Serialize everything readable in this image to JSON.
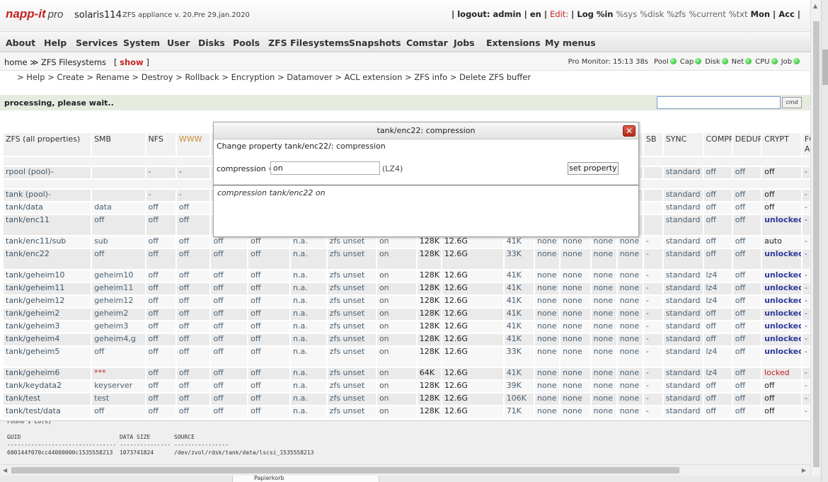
{
  "header": {
    "logo_text": "napp-it",
    "logo_pro": "pro",
    "hostname": "solaris114",
    "appliance": "ZFS appliance v. 20.Pre 29.jan.2020",
    "right_items": [
      "|",
      "logout: admin",
      "|",
      "en",
      "|",
      "Edit:",
      "|",
      "Log %in",
      "%sys",
      "%disk",
      "%zfs",
      "%current",
      "%txt",
      "Mon",
      "|",
      "Acc",
      "|"
    ]
  },
  "menu": [
    "About",
    "Help",
    "Services",
    "System",
    "User",
    "Disks",
    "Pools",
    "ZFS Filesystems",
    "Snapshots",
    "Comstar",
    "Jobs",
    "Extensions",
    "My menus"
  ],
  "breadcrumb": {
    "text": "home ≫ ZFS Filesystems   [",
    "show": "show",
    "close": "]"
  },
  "promonitor": {
    "label": "Pro Monitor: 15:13 38s",
    "items": [
      "Pool",
      "Cap",
      "Disk",
      "Net",
      "CPU",
      "Job"
    ]
  },
  "subnav": "> Help > Create > Rename > Destroy > Rollback > Encryption > Datamover > ACL extension > ZFS info > Delete ZFS buffer",
  "processing": "processing, please wait..",
  "cmd_label": "cmd",
  "table": {
    "headers": [
      "ZFS (all properties)",
      "SMB",
      "NFS",
      "WWW",
      "",
      "",
      "",
      "",
      "",
      "",
      "",
      "",
      "",
      "",
      "",
      "",
      "SB",
      "SYNC",
      "COMPR",
      "DEDUP",
      "CRYPT",
      "FO ACL"
    ],
    "rows": [
      {
        "type": "sp"
      },
      {
        "type": "w1",
        "cells": [
          "rpool (pool)-",
          "",
          "-",
          "-",
          "",
          "",
          "",
          "",
          "",
          "",
          "",
          "",
          "",
          "",
          "",
          "",
          "",
          "standard",
          "off",
          "off",
          "off",
          "-"
        ]
      },
      {
        "type": "sp"
      },
      {
        "type": "w1",
        "cells": [
          "tank (pool)-",
          "",
          "-",
          "-",
          "",
          "",
          "",
          "",
          "",
          "",
          "",
          "",
          "",
          "",
          "",
          "",
          "",
          "standard",
          "off",
          "off",
          "off",
          "-"
        ]
      },
      {
        "type": "w2",
        "cells": [
          "tank/data",
          "data",
          "off",
          "off",
          "",
          "",
          "",
          "",
          "",
          "",
          "",
          "",
          "",
          "",
          "",
          "",
          "",
          "standard",
          "off",
          "off",
          "off",
          "-"
        ]
      },
      {
        "type": "w1",
        "tall": true,
        "cells": [
          "tank/enc11",
          "off",
          "off",
          "off",
          "",
          "",
          "",
          "",
          "",
          "",
          "",
          "",
          "",
          "",
          "",
          "",
          "",
          "standard",
          "off",
          "off",
          "unlocked",
          "-"
        ]
      },
      {
        "type": "w2",
        "cells": [
          "tank/enc11/sub",
          "sub",
          "off",
          "off",
          "off",
          "off",
          "n.a.",
          "zfs unset",
          "on",
          "128K",
          "12.6G",
          "41K",
          "none",
          "none",
          "none",
          "none",
          "-",
          "standard",
          "off",
          "off",
          "auto",
          "-"
        ]
      },
      {
        "type": "w1",
        "tall": true,
        "cells": [
          "tank/enc22",
          "off",
          "off",
          "off",
          "off",
          "off",
          "n.a.",
          "zfs unset",
          "on",
          "128K",
          "12.6G",
          "33K",
          "none",
          "none",
          "none",
          "none",
          "-",
          "standard",
          "off",
          "off",
          "unlocked",
          "-"
        ]
      },
      {
        "type": "w2",
        "cells": [
          "tank/geheim10",
          "geheim10",
          "off",
          "off",
          "off",
          "off",
          "n.a.",
          "zfs unset",
          "on",
          "128K",
          "12.6G",
          "41K",
          "none",
          "none",
          "none",
          "none",
          "-",
          "standard",
          "lz4",
          "off",
          "unlocked",
          "-"
        ]
      },
      {
        "type": "w1",
        "cells": [
          "tank/geheim11",
          "geheim11",
          "off",
          "off",
          "off",
          "off",
          "n.a.",
          "zfs unset",
          "on",
          "128K",
          "12.6G",
          "41K",
          "none",
          "none",
          "none",
          "none",
          "-",
          "standard",
          "lz4",
          "off",
          "unlocked",
          "-"
        ]
      },
      {
        "type": "w2",
        "cells": [
          "tank/geheim12",
          "geheim12",
          "off",
          "off",
          "off",
          "off",
          "n.a.",
          "zfs unset",
          "on",
          "128K",
          "12.6G",
          "41K",
          "none",
          "none",
          "none",
          "none",
          "-",
          "standard",
          "lz4",
          "off",
          "unlocked",
          "-"
        ]
      },
      {
        "type": "w1",
        "cells": [
          "tank/geheim2",
          "geheim2",
          "off",
          "off",
          "off",
          "off",
          "n.a.",
          "zfs unset",
          "on",
          "128K",
          "12.6G",
          "41K",
          "none",
          "none",
          "none",
          "none",
          "-",
          "standard",
          "off",
          "off",
          "unlocked",
          "-"
        ]
      },
      {
        "type": "w2",
        "cells": [
          "tank/geheim3",
          "geheim3",
          "off",
          "off",
          "off",
          "off",
          "n.a.",
          "zfs unset",
          "on",
          "128K",
          "12.6G",
          "41K",
          "none",
          "none",
          "none",
          "none",
          "-",
          "standard",
          "off",
          "off",
          "unlocked",
          "-"
        ]
      },
      {
        "type": "w1",
        "cells": [
          "tank/geheim4",
          "geheim4,g",
          "off",
          "off",
          "off",
          "off",
          "n.a.",
          "zfs unset",
          "on",
          "128K",
          "12.6G",
          "41K",
          "none",
          "none",
          "none",
          "none",
          "-",
          "standard",
          "off",
          "off",
          "unlocked",
          "-"
        ]
      },
      {
        "type": "w2",
        "tall": true,
        "cells": [
          "tank/geheim5",
          "off",
          "off",
          "off",
          "off",
          "off",
          "n.a.",
          "zfs unset",
          "on",
          "128K",
          "12.6G",
          "33K",
          "none",
          "none",
          "none",
          "none",
          "-",
          "standard",
          "lz4",
          "off",
          "unlocked",
          "-"
        ]
      },
      {
        "type": "w1",
        "cells": [
          "tank/geheim6",
          "***",
          "off",
          "off",
          "off",
          "off",
          "n.a.",
          "zfs unset",
          "on",
          "64K",
          "12.6G",
          "41K",
          "none",
          "none",
          "none",
          "none",
          "-",
          "standard",
          "lz4",
          "off",
          "locked",
          "-"
        ]
      },
      {
        "type": "w2",
        "cells": [
          "tank/keydata2",
          "keyserver",
          "off",
          "off",
          "off",
          "off",
          "n.a.",
          "zfs unset",
          "on",
          "128K",
          "12.6G",
          "39K",
          "none",
          "none",
          "none",
          "none",
          "-",
          "standard",
          "off",
          "off",
          "off",
          "-"
        ]
      },
      {
        "type": "w1",
        "cells": [
          "tank/test",
          "test",
          "off",
          "off",
          "off",
          "off",
          "n.a.",
          "zfs unset",
          "on",
          "128K",
          "12.6G",
          "106K",
          "none",
          "none",
          "none",
          "none",
          "-",
          "standard",
          "off",
          "off",
          "off",
          "-"
        ]
      },
      {
        "type": "w2",
        "cells": [
          "tank/test/data",
          "off",
          "off",
          "off",
          "off",
          "off",
          "n.a.",
          "zfs unset",
          "on",
          "128K",
          "12.6G",
          "71K",
          "none",
          "none",
          "none",
          "none",
          "-",
          "standard",
          "off",
          "off",
          "off",
          "-"
        ]
      }
    ]
  },
  "bottom_lines": [
    "Found 1 LU(s)",
    "",
    "GUID                             DATA SIZE       SOURCE",
    "-------------------------------- --------------- ----------------",
    "600144f070cc44000000c1535558213  1073741824      /dev/zvol/rdsk/tank/data/lscsi_1535558213"
  ],
  "dialog": {
    "title": "tank/enc22: compression",
    "heading": "Change property tank/enc22/: compression",
    "prop_label": "compression =",
    "prop_value": "on",
    "prop_type": "(LZ4)",
    "button": "set property",
    "result": "compression tank/enc22 on",
    "close": "✕"
  },
  "bg_panel_text": "Papierkorb"
}
